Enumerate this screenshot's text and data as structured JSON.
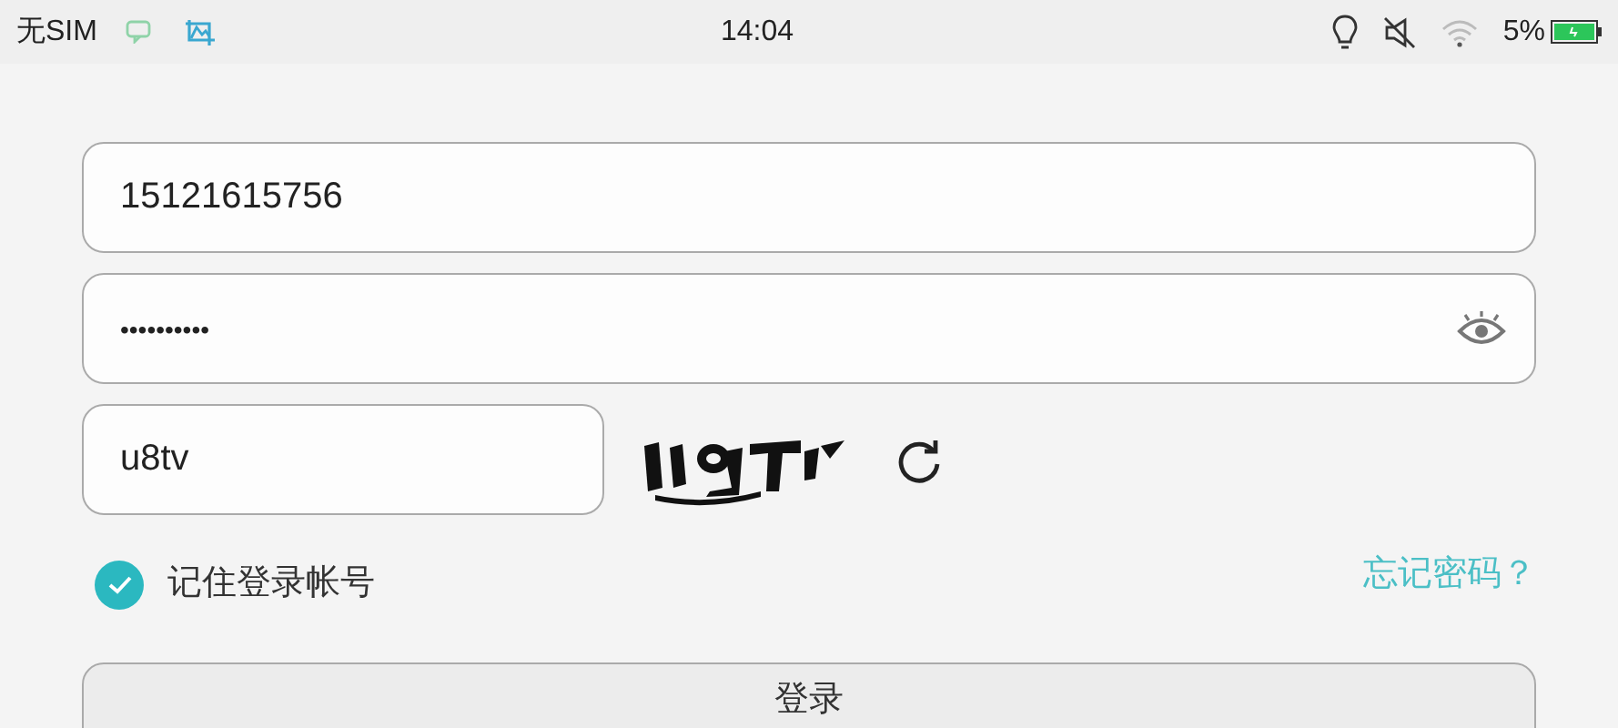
{
  "status_bar": {
    "carrier": "无SIM",
    "time": "14:04",
    "battery_percent": "5%"
  },
  "phone_field": {
    "value": "15121615756"
  },
  "password_field": {
    "value": "••••••••••"
  },
  "captcha_field": {
    "value": "u8tv"
  },
  "remember_account": {
    "label": "记住登录帐号",
    "checked": true
  },
  "forgot_password": {
    "label": "忘记密码？"
  },
  "login_button": {
    "label": "登录"
  }
}
